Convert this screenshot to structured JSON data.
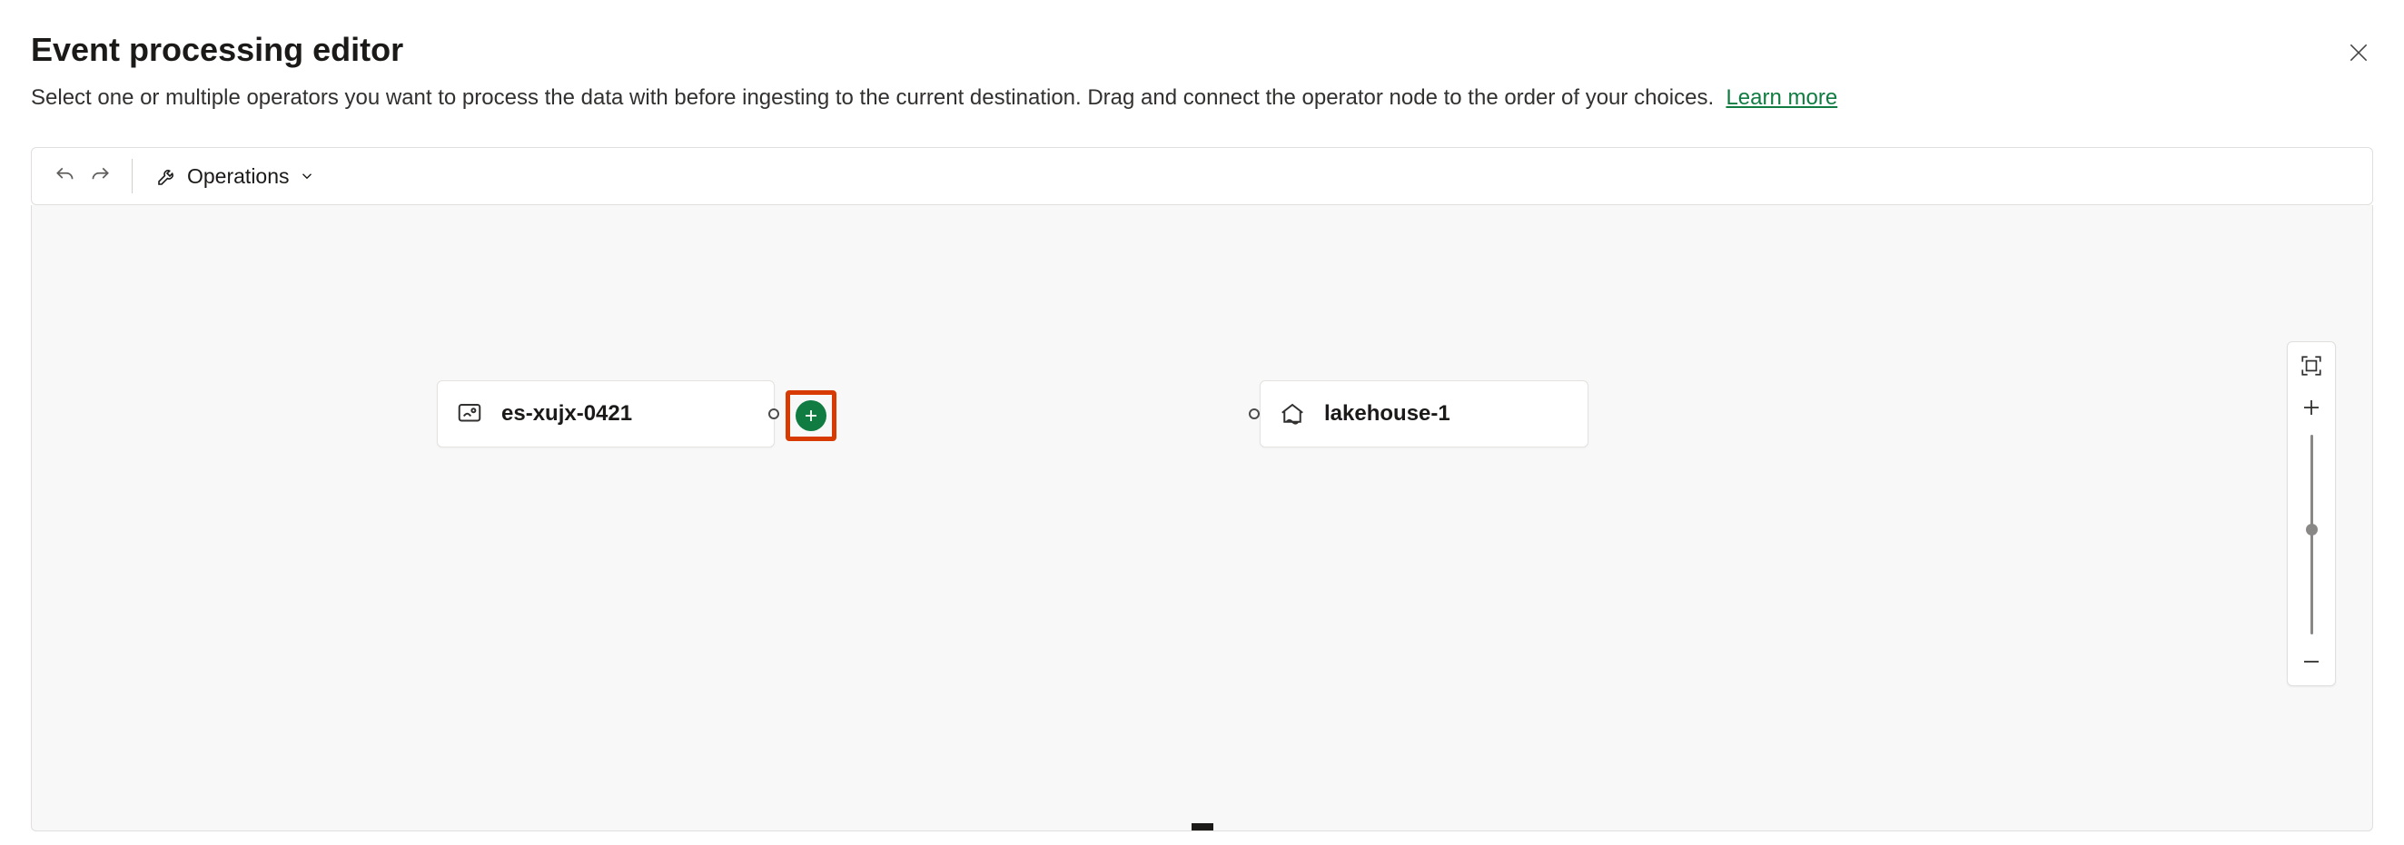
{
  "header": {
    "title": "Event processing editor",
    "subtitle": "Select one or multiple operators you want to process the data with before ingesting to the current destination. Drag and connect the operator node to the order of your choices.",
    "learn_more": "Learn more"
  },
  "toolbar": {
    "operations_label": "Operations"
  },
  "nodes": {
    "source": {
      "label": "es-xujx-0421"
    },
    "destination": {
      "label": "lakehouse-1"
    }
  },
  "icons": {
    "close": "close-icon",
    "undo": "undo-icon",
    "redo": "redo-icon",
    "wrench": "wrench-icon",
    "chevron_down": "chevron-down-icon",
    "stream": "stream-source-icon",
    "lakehouse": "lakehouse-icon",
    "plus": "plus-icon",
    "fit": "fit-to-screen-icon",
    "zoom_in": "zoom-in-icon",
    "zoom_out": "zoom-out-icon"
  },
  "colors": {
    "accent": "#107c41",
    "highlight": "#d83b01"
  }
}
